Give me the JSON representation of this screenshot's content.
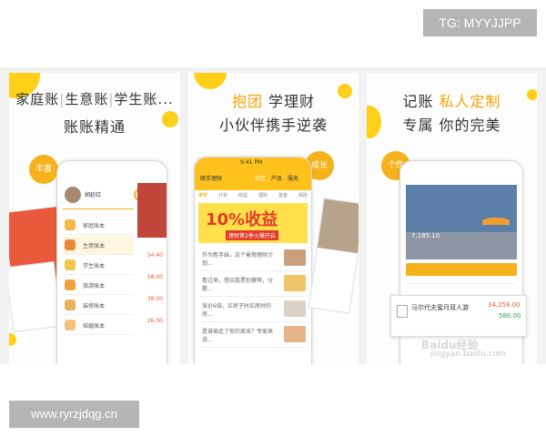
{
  "watermarks": {
    "top": "TG: MYYJJPP",
    "bottom": "www.ryrzjdqg.cn"
  },
  "panel1": {
    "headline_parts": [
      "家庭账",
      "生意账",
      "学生账..."
    ],
    "subheadline": "账账精通",
    "tag": "丰富",
    "user_name": "胡延红",
    "book_items": [
      "家庭账本",
      "生意账本",
      "学生账本",
      "旅游账本",
      "装修账本",
      "结婚账本"
    ],
    "side_numbers": [
      "54.40",
      "58.00",
      "38.00",
      "26.00"
    ]
  },
  "panel2": {
    "headline_left": "抱团",
    "headline_right": "学理财",
    "subheadline": "小伙伴携手逆袭",
    "tag": "成长",
    "status_time": "9:41 PM",
    "back_label": "随手理财",
    "tabs": [
      "社区",
      "产品",
      "服务"
    ],
    "nav": [
      "推荐",
      "计划",
      "收益",
      "理财",
      "基金",
      "保险"
    ],
    "banner_big": "10%收益",
    "banner_small": "理财第2季火爆开启",
    "feed": [
      "作为新手妹，这个暑假理财计划...",
      "看过来，想买股票别傻等，分散...",
      "涨价6倍，买房子时买房时的房...",
      "是谁偷走了你的周末？专家来说..."
    ]
  },
  "panel3": {
    "headline_left": "记账",
    "headline_right": "私人定制",
    "subheadline": "专属 你的完美",
    "tag": "个性",
    "amount": "7,185.10",
    "item_name": "马尔代夫蜜月双人游",
    "item_value": "34,258.00",
    "item_value2": "586.00",
    "baidu_logo": "Baidu经验",
    "baidu_url": "jingyan.baidu.com"
  }
}
